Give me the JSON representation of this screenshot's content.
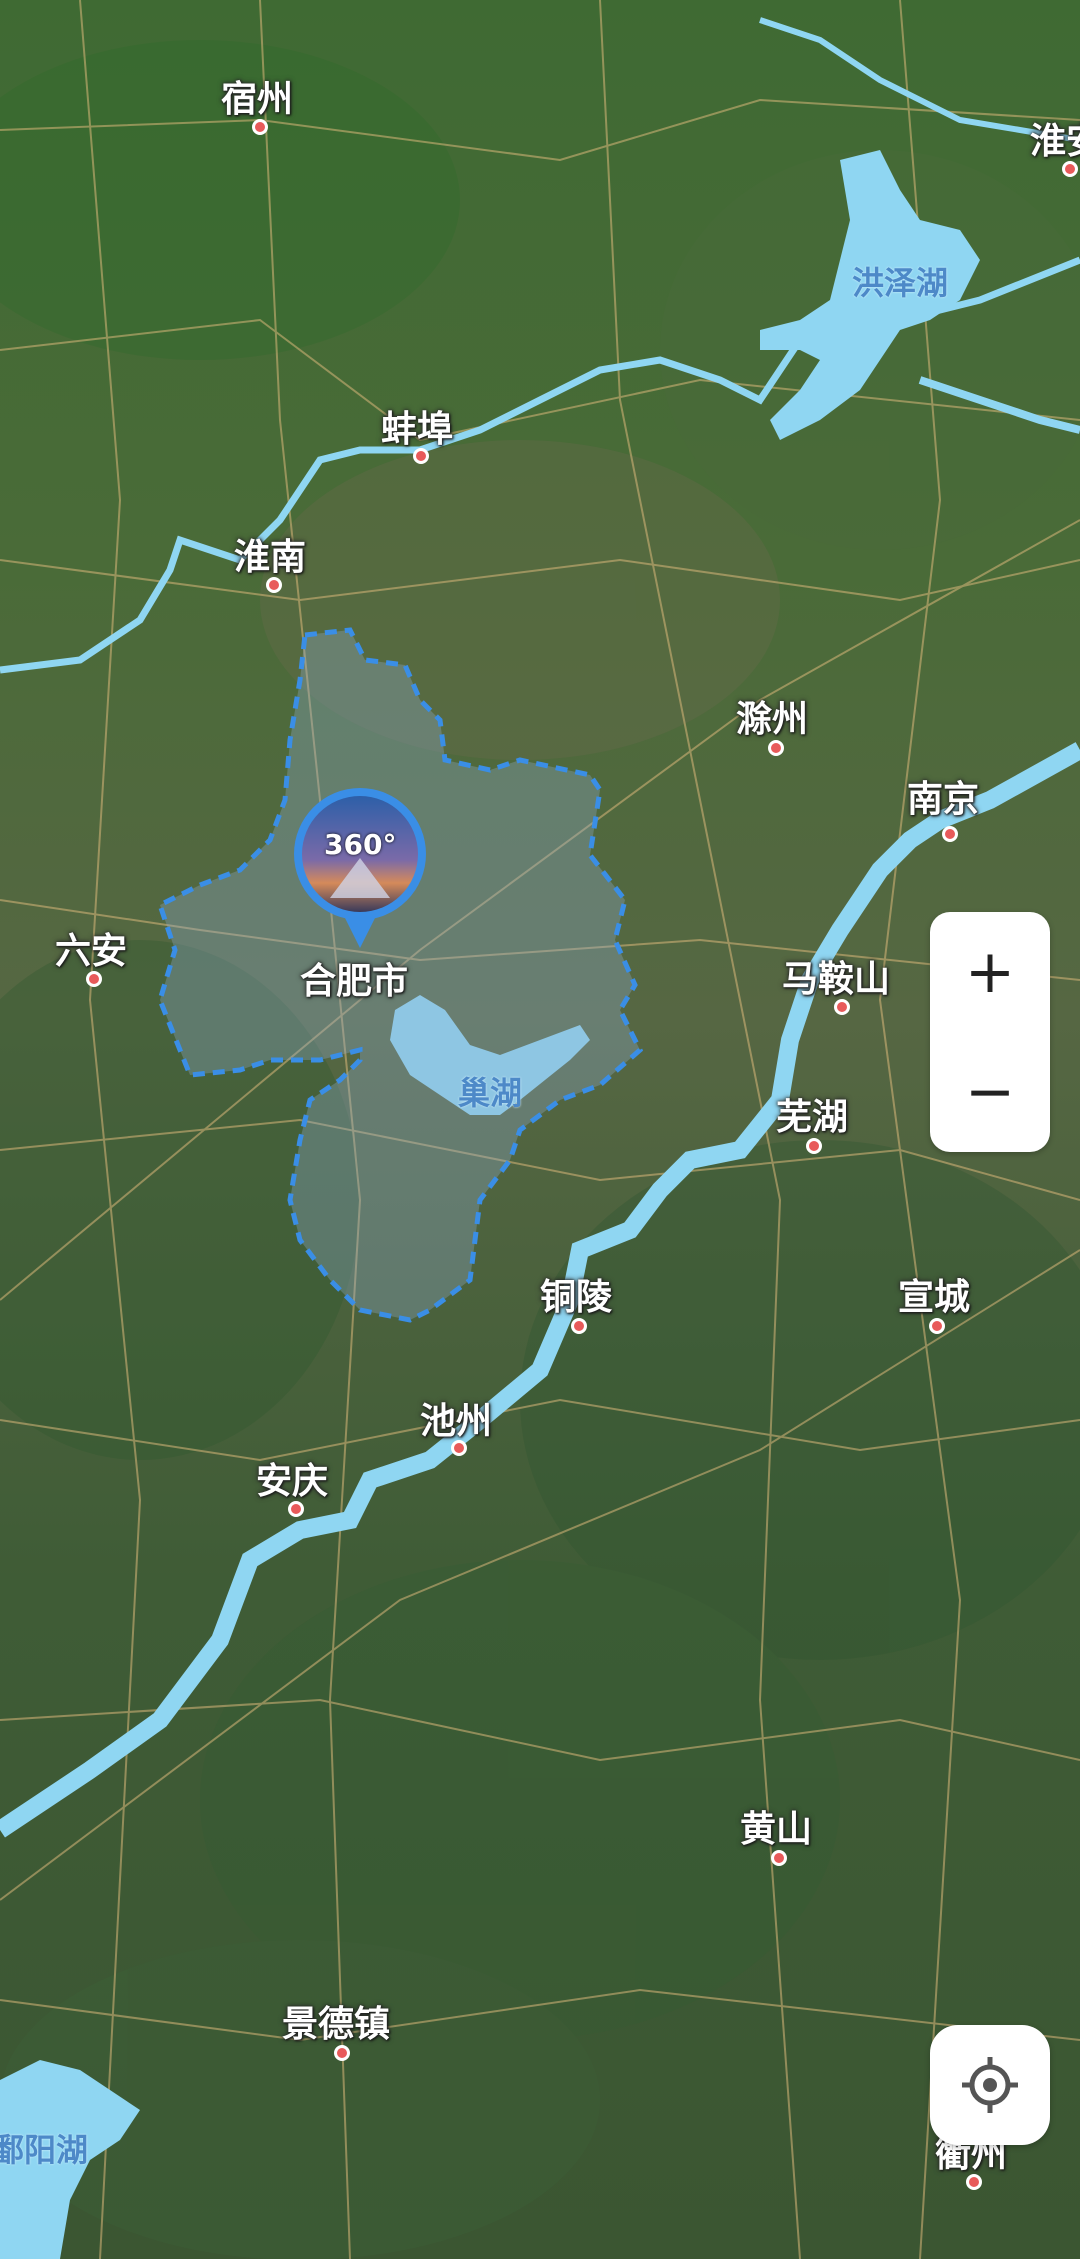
{
  "map": {
    "cities": [
      {
        "name": "宿州"
      },
      {
        "name": "淮安"
      },
      {
        "name": "蚌埠"
      },
      {
        "name": "淮南"
      },
      {
        "name": "滁州"
      },
      {
        "name": "南京"
      },
      {
        "name": "六安"
      },
      {
        "name": "合肥市"
      },
      {
        "name": "马鞍山"
      },
      {
        "name": "芜湖"
      },
      {
        "name": "铜陵"
      },
      {
        "name": "宣城"
      },
      {
        "name": "池州"
      },
      {
        "name": "安庆"
      },
      {
        "name": "黄山"
      },
      {
        "name": "景德镇"
      },
      {
        "name": "衢州"
      }
    ],
    "lakes": [
      {
        "name": "洪泽湖"
      },
      {
        "name": "巢湖"
      },
      {
        "name": "鄱阳湖"
      }
    ],
    "marker": {
      "badge": "360°",
      "icon": "panorama-360-icon"
    },
    "highlight_color": "#3a8ee6",
    "water_color": "#8fd6f2"
  },
  "controls": {
    "zoom_in": "+",
    "zoom_out": "−",
    "locate_icon": "locate-crosshair-icon"
  }
}
